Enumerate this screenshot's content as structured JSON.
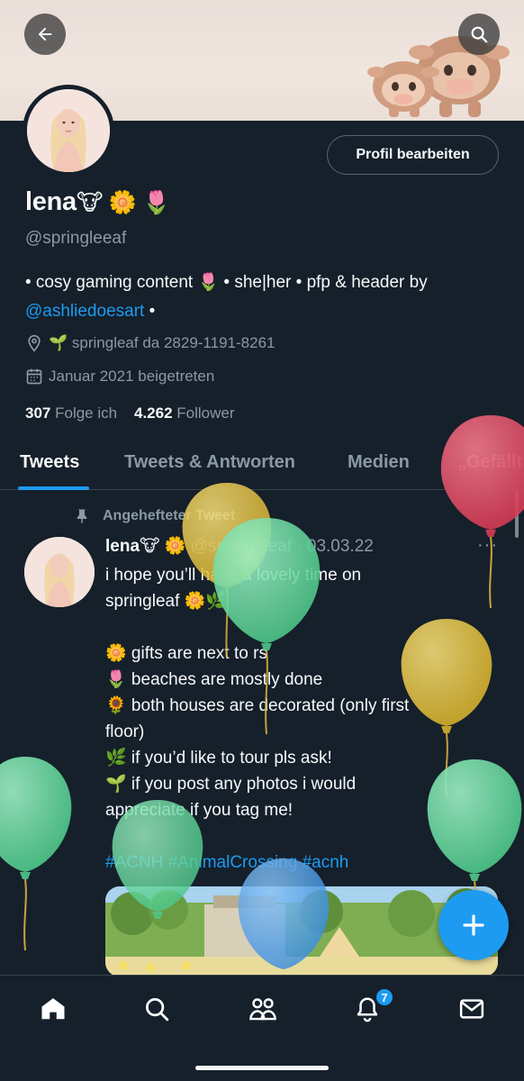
{
  "colors": {
    "background": "#15202b",
    "accent": "#1d9bf0",
    "text": "#f7f9f9",
    "muted": "#8b98a5",
    "balloon_green": "#5fd39a",
    "balloon_yellow": "#e8c53f",
    "balloon_red": "#e04a63",
    "balloon_blue": "#4a9ee8"
  },
  "profile": {
    "edit_button": "Profil bearbeiten",
    "name": "lena",
    "name_emojis": "🐮 🌼 🌷",
    "handle": "@springleeaf",
    "bio_text": "• cosy gaming content 🌷 • she|her • pfp & header by ",
    "bio_link": "@ashliedoesart",
    "bio_tail": " •",
    "location": "🌱 springleaf da 2829-1191-8261",
    "joined": "Januar 2021 beigetreten",
    "following_count": "307",
    "following_label": "Folge ich",
    "followers_count": "4.262",
    "followers_label": "Follower"
  },
  "tabs": [
    {
      "label": "Tweets",
      "active": true
    },
    {
      "label": "Tweets & Antworten",
      "active": false
    },
    {
      "label": "Medien",
      "active": false
    },
    {
      "label": "„Gefällt mir“",
      "active": false
    }
  ],
  "tweet": {
    "pinned_label": "Angehefteter Tweet",
    "author": "lena",
    "author_emojis": "🐮 🌼",
    "meta": "@springleeaf · 03.03.22",
    "more": "···",
    "lines": [
      "i hope you’ll have a lovely time on",
      "springleaf 🌼🌿",
      "",
      "🌼 gifts are next to rs",
      "🌷 beaches are mostly done",
      "🌻 both houses are decorated (only first",
      "floor)",
      "🌿 if you’d like to tour pls ask!",
      "🌱 if you post any photos i would",
      "appreciate if you tag me!",
      ""
    ],
    "hashtags": "#ACNH #AnimalCrossing #acnh"
  },
  "nav": {
    "icons": [
      "home-icon",
      "search-icon",
      "communities-icon",
      "notifications-icon",
      "messages-icon"
    ],
    "notification_badge": "7"
  },
  "icons": {
    "back": "arrow-left-icon",
    "search": "search-icon",
    "location": "location-pin-icon",
    "calendar": "calendar-icon",
    "pin": "pin-icon",
    "compose": "plus-icon"
  }
}
